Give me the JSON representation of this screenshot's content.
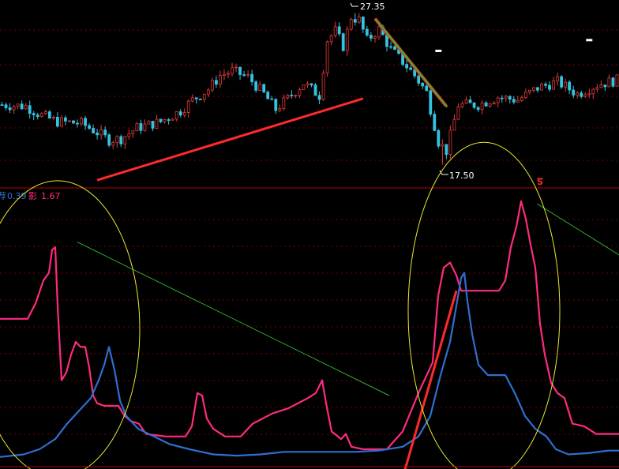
{
  "chart_data": [
    {
      "type": "candlestick",
      "title": "",
      "annotations": {
        "high_label": "27.35",
        "low_label": "17.50",
        "marker_symbol": "S",
        "high_value": 27.35,
        "low_value": 17.5
      },
      "ylim": [
        16.2,
        28.0
      ],
      "x_count": 156,
      "grid": true,
      "colors": {
        "up": "#e03a3a",
        "down": "#35c3e0",
        "flat": "#ffffff",
        "grid": "#7a0000",
        "trend": "#ff2a2a",
        "trend_green": "#2fb32f",
        "marker": "#ff2a2a"
      },
      "anchors": [
        [
          0,
          21.4
        ],
        [
          6,
          21.3
        ],
        [
          10,
          20.7
        ],
        [
          14,
          20.3
        ],
        [
          20,
          20.2
        ],
        [
          24,
          19.6
        ],
        [
          27,
          19.1
        ],
        [
          30,
          19.2
        ],
        [
          34,
          19.9
        ],
        [
          40,
          20.3
        ],
        [
          45,
          21.0
        ],
        [
          48,
          21.7
        ],
        [
          52,
          22.4
        ],
        [
          55,
          23.3
        ],
        [
          58,
          23.6
        ],
        [
          62,
          23.2
        ],
        [
          66,
          22.1
        ],
        [
          69,
          21.1
        ],
        [
          72,
          21.8
        ],
        [
          76,
          22.8
        ],
        [
          80,
          22.0
        ],
        [
          82,
          25.6
        ],
        [
          84,
          26.2
        ],
        [
          86,
          25.2
        ],
        [
          88,
          27.1
        ],
        [
          90,
          26.9
        ],
        [
          92,
          25.6
        ],
        [
          95,
          26.3
        ],
        [
          98,
          25.0
        ],
        [
          101,
          24.2
        ],
        [
          104,
          23.3
        ],
        [
          107,
          22.2
        ],
        [
          110,
          19.0
        ],
        [
          112,
          18.4
        ],
        [
          115,
          21.4
        ],
        [
          120,
          21.4
        ],
        [
          125,
          21.9
        ],
        [
          130,
          21.7
        ],
        [
          135,
          22.5
        ],
        [
          140,
          22.9
        ],
        [
          145,
          22.1
        ],
        [
          150,
          22.7
        ],
        [
          155,
          23.0
        ]
      ],
      "trendlines": [
        {
          "color": "red",
          "from": [
            24,
            16.5
          ],
          "to": [
            91,
            21.8
          ]
        },
        {
          "color": "red-green",
          "from": [
            94,
            27.0
          ],
          "to": [
            112,
            21.3
          ]
        }
      ],
      "white_marks": [
        [
          110,
          24.9
        ],
        [
          148,
          25.6
        ]
      ]
    },
    {
      "type": "line",
      "title": "",
      "legend": [
        {
          "name": "0.39",
          "prefix_glyph": "荐",
          "color": "#2e6fd0"
        },
        {
          "name": "1.67",
          "prefix_glyph": "影",
          "color": "#ff2a80"
        }
      ],
      "ylim": [
        0,
        10
      ],
      "x": [
        0,
        784
      ],
      "grid": true,
      "series": [
        {
          "name": "1.67",
          "color": "#ff2a80",
          "points": [
            [
              0,
              5.5
            ],
            [
              35,
              5.5
            ],
            [
              45,
              6.1
            ],
            [
              55,
              7.0
            ],
            [
              62,
              7.3
            ],
            [
              66,
              8.2
            ],
            [
              70,
              8.3
            ],
            [
              73,
              6.0
            ],
            [
              78,
              3.1
            ],
            [
              84,
              3.4
            ],
            [
              90,
              4.1
            ],
            [
              96,
              4.6
            ],
            [
              102,
              4.4
            ],
            [
              108,
              4.4
            ],
            [
              113,
              3.6
            ],
            [
              118,
              2.5
            ],
            [
              123,
              2.2
            ],
            [
              132,
              2.1
            ],
            [
              142,
              2.1
            ],
            [
              150,
              2.1
            ],
            [
              158,
              1.7
            ],
            [
              166,
              1.5
            ],
            [
              176,
              1.4
            ],
            [
              185,
              1.0
            ],
            [
              210,
              0.9
            ],
            [
              235,
              0.9
            ],
            [
              243,
              1.3
            ],
            [
              250,
              2.6
            ],
            [
              256,
              2.5
            ],
            [
              262,
              1.6
            ],
            [
              270,
              1.2
            ],
            [
              285,
              0.9
            ],
            [
              305,
              0.9
            ],
            [
              320,
              1.4
            ],
            [
              345,
              1.8
            ],
            [
              365,
              2.0
            ],
            [
              390,
              2.4
            ],
            [
              400,
              2.6
            ],
            [
              408,
              3.1
            ],
            [
              413,
              2.2
            ],
            [
              420,
              1.1
            ],
            [
              432,
              0.8
            ],
            [
              438,
              1.0
            ],
            [
              445,
              0.5
            ],
            [
              460,
              0.4
            ],
            [
              490,
              0.4
            ],
            [
              510,
              1.1
            ],
            [
              530,
              2.6
            ],
            [
              548,
              3.8
            ],
            [
              555,
              6.4
            ],
            [
              562,
              7.5
            ],
            [
              570,
              7.7
            ],
            [
              578,
              7.2
            ],
            [
              584,
              6.6
            ],
            [
              596,
              6.6
            ],
            [
              618,
              6.6
            ],
            [
              632,
              6.6
            ],
            [
              640,
              7.0
            ],
            [
              647,
              8.3
            ],
            [
              654,
              9.1
            ],
            [
              660,
              10.1
            ],
            [
              666,
              9.4
            ],
            [
              672,
              8.4
            ],
            [
              678,
              7.5
            ],
            [
              684,
              5.3
            ],
            [
              690,
              4.1
            ],
            [
              698,
              3.0
            ],
            [
              706,
              2.6
            ],
            [
              715,
              2.4
            ],
            [
              725,
              1.4
            ],
            [
              740,
              1.3
            ],
            [
              755,
              1.0
            ],
            [
              784,
              1.0
            ]
          ]
        },
        {
          "name": "0.39",
          "color": "#2e6fd0",
          "points": [
            [
              0,
              0.1
            ],
            [
              30,
              0.2
            ],
            [
              50,
              0.4
            ],
            [
              70,
              0.8
            ],
            [
              85,
              1.4
            ],
            [
              100,
              1.9
            ],
            [
              115,
              2.4
            ],
            [
              125,
              3.1
            ],
            [
              132,
              3.7
            ],
            [
              138,
              4.4
            ],
            [
              145,
              3.5
            ],
            [
              152,
              2.3
            ],
            [
              160,
              1.7
            ],
            [
              175,
              1.2
            ],
            [
              195,
              0.9
            ],
            [
              215,
              0.6
            ],
            [
              240,
              0.4
            ],
            [
              270,
              0.2
            ],
            [
              300,
              0.15
            ],
            [
              330,
              0.2
            ],
            [
              360,
              0.3
            ],
            [
              390,
              0.3
            ],
            [
              420,
              0.3
            ],
            [
              450,
              0.3
            ],
            [
              480,
              0.35
            ],
            [
              510,
              0.5
            ],
            [
              530,
              0.9
            ],
            [
              545,
              1.7
            ],
            [
              558,
              3.3
            ],
            [
              570,
              4.6
            ],
            [
              578,
              6.0
            ],
            [
              584,
              7.1
            ],
            [
              588,
              7.3
            ],
            [
              592,
              6.2
            ],
            [
              598,
              4.9
            ],
            [
              606,
              3.7
            ],
            [
              618,
              3.3
            ],
            [
              640,
              3.3
            ],
            [
              652,
              2.6
            ],
            [
              665,
              1.7
            ],
            [
              678,
              1.2
            ],
            [
              692,
              0.9
            ],
            [
              704,
              0.4
            ],
            [
              720,
              0.2
            ],
            [
              745,
              0.25
            ],
            [
              770,
              0.35
            ],
            [
              784,
              0.35
            ]
          ]
        }
      ],
      "trendlines": [
        {
          "color": "green",
          "from": [
            98,
            8.5
          ],
          "to": [
            493,
            2.5
          ]
        },
        {
          "color": "green",
          "from": [
            680,
            10.0
          ],
          "to": [
            784,
            8.0
          ]
        },
        {
          "color": "red",
          "from": [
            512,
            -0.5
          ],
          "to": [
            578,
            6.6
          ]
        }
      ],
      "ellipses": [
        {
          "cx": 73,
          "cy": 5.1,
          "rx": 104,
          "ry": 5.8,
          "color": "yellow"
        },
        {
          "cx": 613,
          "cy": 5.8,
          "rx": 96,
          "ry": 6.6,
          "color": "yellow"
        }
      ]
    }
  ]
}
